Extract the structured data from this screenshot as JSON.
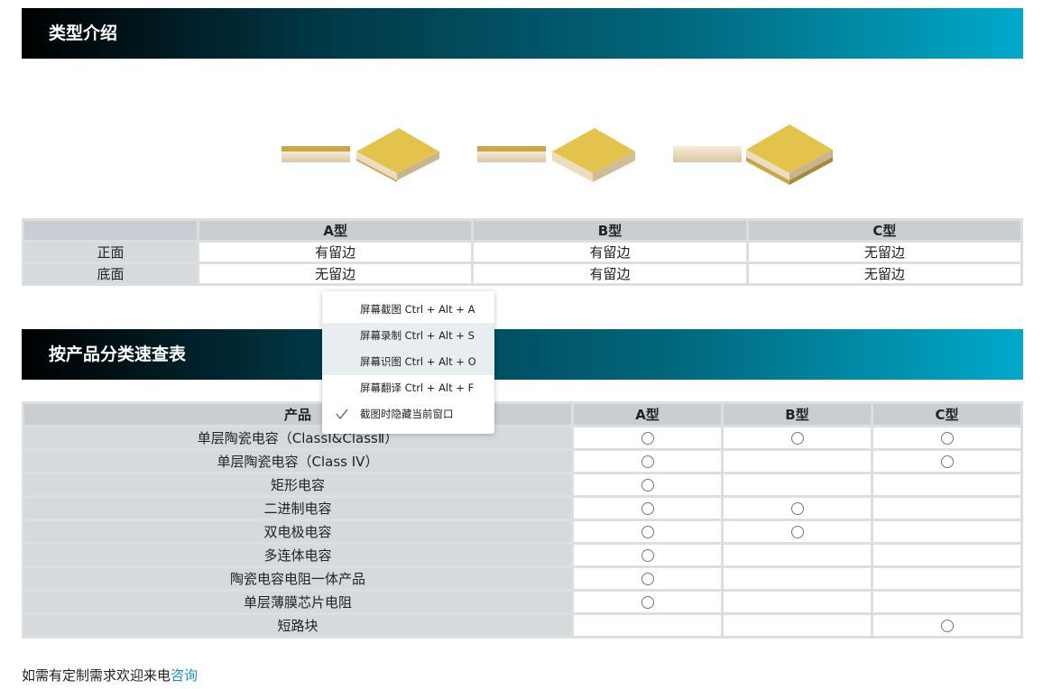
{
  "section1": {
    "title": "类型介绍"
  },
  "section2": {
    "title": "按产品分类速查表"
  },
  "type_table": {
    "headers": [
      "",
      "A型",
      "B型",
      "C型"
    ],
    "rows": [
      {
        "label": "正面",
        "values": [
          "有留边",
          "有留边",
          "无留边"
        ]
      },
      {
        "label": "底面",
        "values": [
          "无留边",
          "有留边",
          "无留边"
        ]
      }
    ]
  },
  "product_table": {
    "headers": [
      "产品",
      "A型",
      "B型",
      "C型"
    ],
    "rows": [
      {
        "label": "单层陶瓷电容（ClassⅠ&ClassⅡ）",
        "marks": [
          true,
          true,
          true
        ]
      },
      {
        "label": "单层陶瓷电容（Class IV）",
        "marks": [
          true,
          false,
          true
        ]
      },
      {
        "label": "矩形电容",
        "marks": [
          true,
          false,
          false
        ]
      },
      {
        "label": "二进制电容",
        "marks": [
          true,
          true,
          false
        ]
      },
      {
        "label": "双电极电容",
        "marks": [
          true,
          true,
          false
        ]
      },
      {
        "label": "多连体电容",
        "marks": [
          true,
          false,
          false
        ]
      },
      {
        "label": "陶瓷电容电阻一体产品",
        "marks": [
          true,
          false,
          false
        ]
      },
      {
        "label": "单层薄膜芯片电阻",
        "marks": [
          true,
          false,
          false
        ]
      },
      {
        "label": "短路块",
        "marks": [
          false,
          false,
          true
        ]
      }
    ]
  },
  "footer": {
    "text": "如需有定制需求欢迎来电",
    "link": "咨询"
  },
  "context_menu": {
    "items": [
      {
        "label": "屏幕截图 Ctrl + Alt + A",
        "checked": false
      },
      {
        "label": "屏幕录制 Ctrl + Alt + S",
        "checked": false
      },
      {
        "label": "屏幕识图 Ctrl + Alt + O",
        "checked": false
      },
      {
        "label": "屏幕翻译 Ctrl + Alt + F",
        "checked": false
      },
      {
        "label": "截图时隐藏当前窗口",
        "checked": true
      }
    ]
  },
  "colors": {
    "banner_start": "#000000",
    "banner_end": "#01a9cb",
    "link": "#1a8fc9",
    "header_bg": "#c9ced2"
  }
}
